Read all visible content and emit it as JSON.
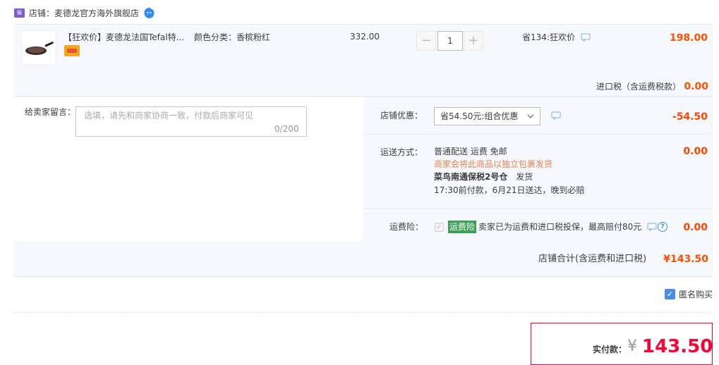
{
  "shop": {
    "icon": "tmall-cat-icon",
    "label": "店铺：麦德龙官方海外旗舰店",
    "chat_icon": "wangwang-chat-icon"
  },
  "item": {
    "title": "【狂欢价】麦德龙法国Tefal特...",
    "sku": "颜色分类：香槟粉红",
    "unit_price": "332.00",
    "quantity": "1",
    "minus": "−",
    "plus": "+",
    "discount": "省134:狂欢价",
    "total": "198.00",
    "tax_label": "进口税（含运费税款）",
    "tax_value": "0.00"
  },
  "note": {
    "label": "给卖家留言：",
    "placeholder": "选填，请先和商家协商一致，付款后商家可见",
    "count": "0/200"
  },
  "promo": {
    "label": "店铺优惠：",
    "selected": "省54.50元:组合优惠",
    "value": "-54.50"
  },
  "shipping": {
    "label": "运送方式：",
    "method": "普通配送 运费 免邮",
    "notice": "商家会将此商品以独立包裹发货",
    "warehouse": "菜鸟南通保税2号仓",
    "warehouse_suffix": "发货",
    "eta": "17:30前付款，6月21日送达，晚到必赔",
    "value": "0.00"
  },
  "insurance": {
    "label": "运费险：",
    "badge": "运费险",
    "text": "卖家已为运费和进口税投保，最高赔付80元",
    "help": "?",
    "value": "0.00"
  },
  "summary": {
    "label": "店铺合计(含运费和进口税)",
    "value": "¥143.50"
  },
  "anonymous": {
    "label": "匿名购买",
    "checked": "✓"
  },
  "payment": {
    "label": "实付款：",
    "currency": "¥",
    "amount": "143.50"
  },
  "colors": {
    "price": "#ff5000",
    "pay": "#ff0036",
    "panel": "#f5f8fd",
    "badge_green": "#3ca056",
    "checkbox_blue": "#4a8de2"
  }
}
